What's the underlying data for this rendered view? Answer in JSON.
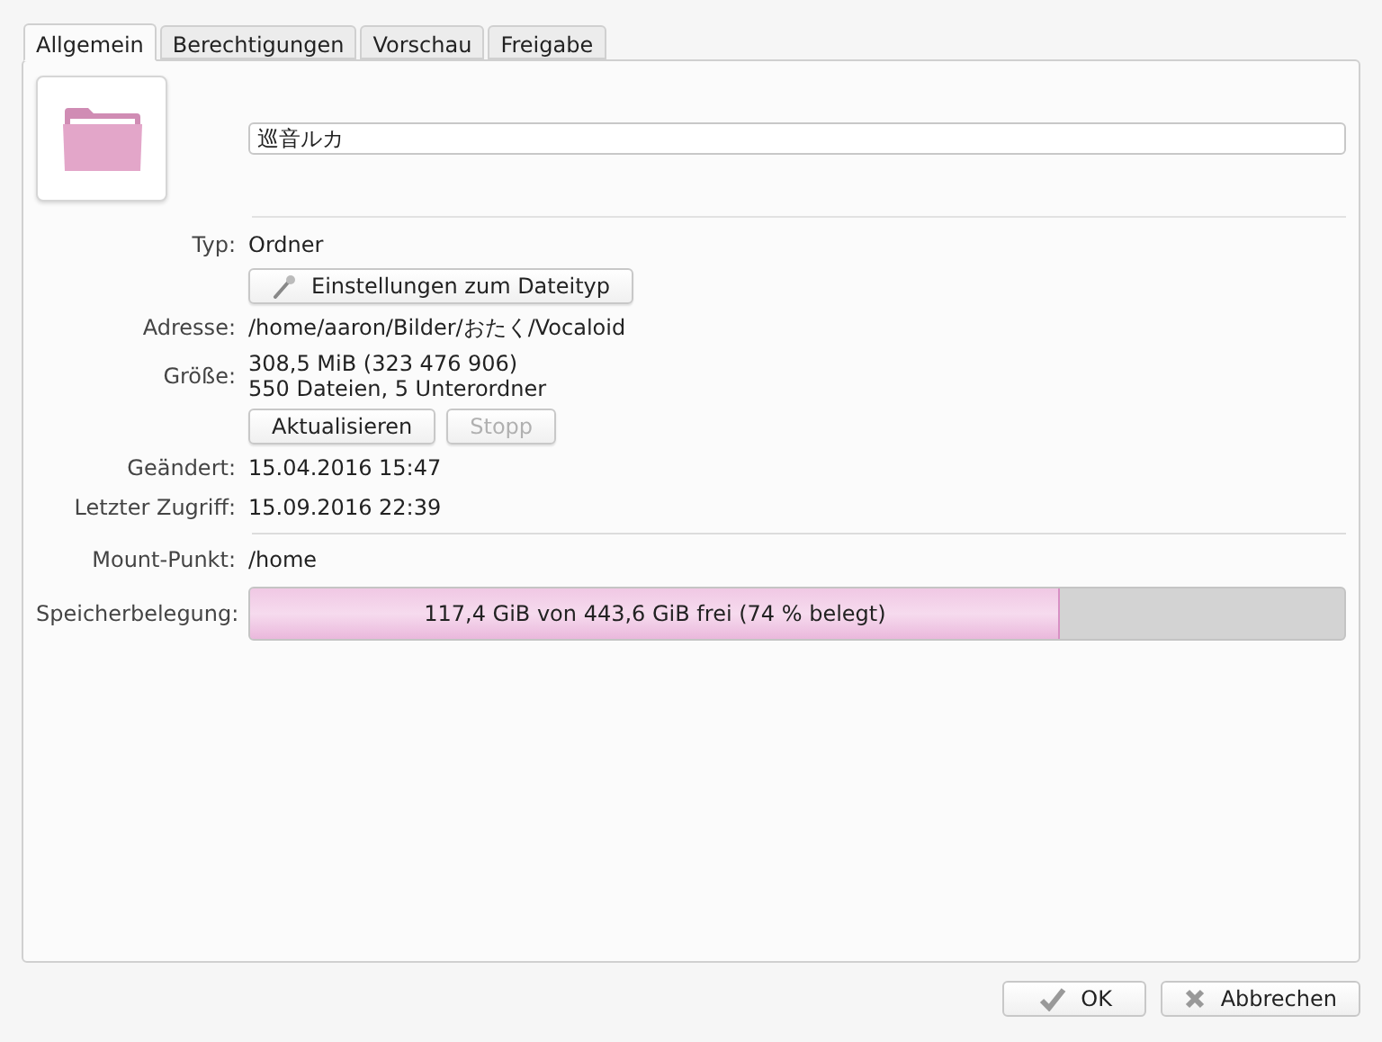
{
  "tabs": [
    {
      "label": "Allgemein",
      "selected": true
    },
    {
      "label": "Berechtigungen",
      "selected": false
    },
    {
      "label": "Vorschau",
      "selected": false
    },
    {
      "label": "Freigabe",
      "selected": false
    }
  ],
  "name_field": {
    "value": "巡音ルカ"
  },
  "rows": [
    {
      "kind": "text",
      "label": "Typ:",
      "lines": [
        "Ordner"
      ]
    },
    {
      "kind": "buttons",
      "buttons": [
        {
          "label": "Einstellungen zum Dateityp",
          "kind": "file_type",
          "disabled": false
        }
      ]
    },
    {
      "kind": "text",
      "label": "Adresse:",
      "lines": [
        "/home/aaron/Bilder/おたく/Vocaloid"
      ]
    },
    {
      "kind": "text",
      "label": "Größe:",
      "lines": [
        "308,5 MiB (323 476 906)",
        "550 Dateien, 5 Unterordner"
      ]
    },
    {
      "kind": "buttons",
      "buttons": [
        {
          "label": "Aktualisieren",
          "kind": "refresh",
          "disabled": false
        },
        {
          "label": "Stopp",
          "kind": "stop",
          "disabled": true
        }
      ]
    },
    {
      "kind": "text",
      "label": "Geändert:",
      "lines": [
        "15.04.2016 15:47"
      ]
    },
    {
      "kind": "text",
      "label": "Letzter Zugriff:",
      "lines": [
        "15.09.2016 22:39"
      ]
    },
    {
      "kind": "divider"
    },
    {
      "kind": "text",
      "label": "Mount-Punkt:",
      "lines": [
        "/home"
      ]
    },
    {
      "kind": "meter",
      "label": "Speicherbelegung:",
      "level": 0.74,
      "reading": "117,4 GiB von 443,6 GiB frei (74 % belegt)"
    }
  ],
  "dialog_buttons": [
    {
      "label": "OK",
      "kind": "ok"
    },
    {
      "label": "Abbrechen",
      "kind": "cancel"
    }
  ]
}
